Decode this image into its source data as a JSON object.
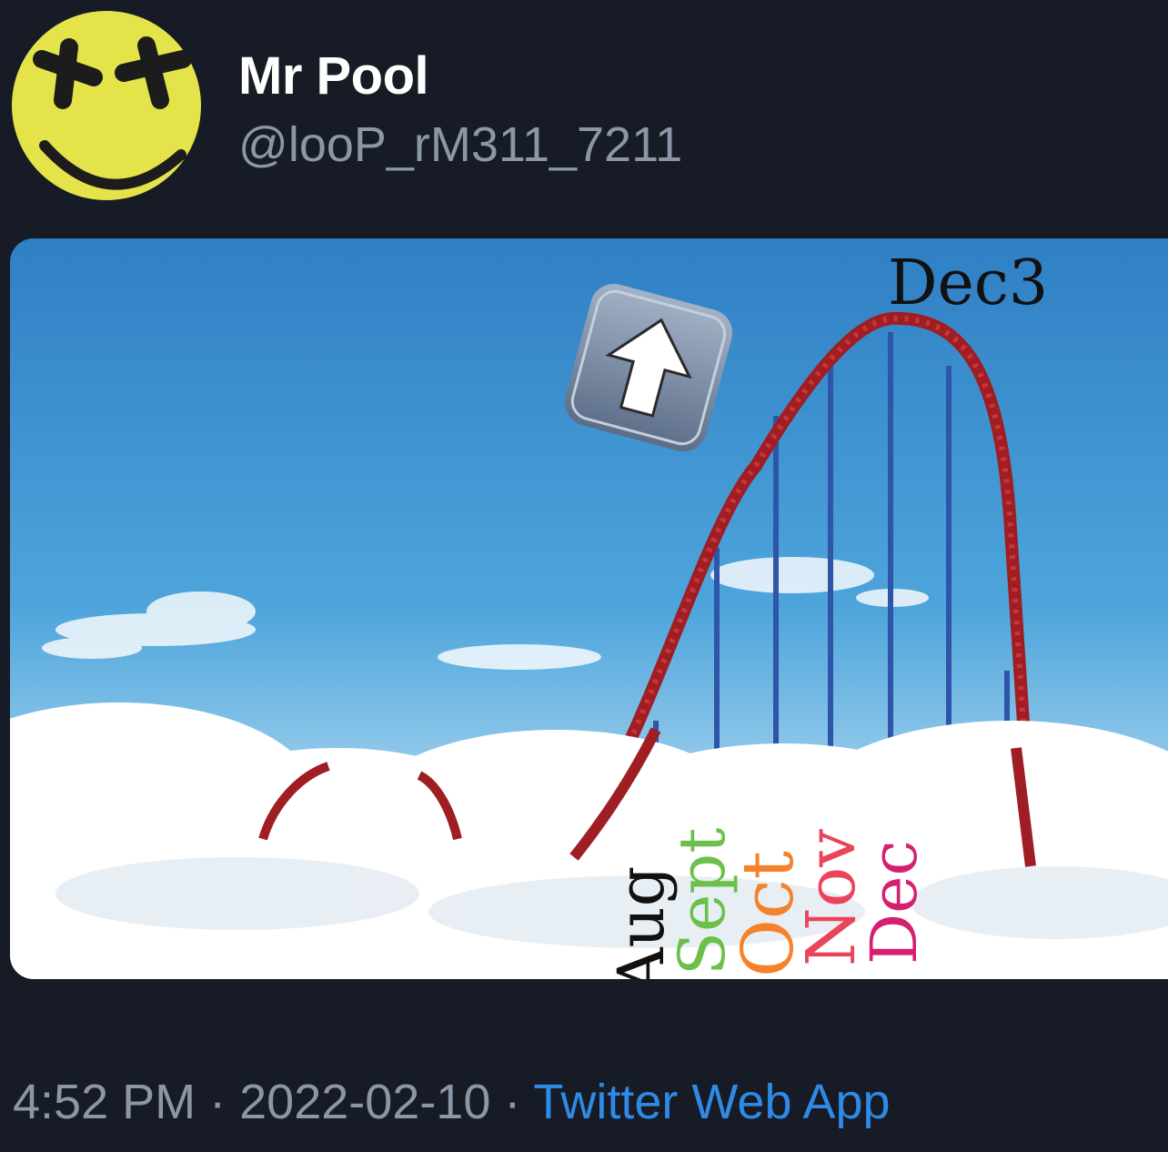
{
  "tweet": {
    "author_name": "Mr Pool",
    "author_handle": "@looP_rM311_7211",
    "time": "4:52 PM",
    "date": "2022-02-10",
    "separator": "·",
    "source_app": "Twitter Web App"
  },
  "meme": {
    "peak_label": "Dec3",
    "up_arrow_icon": "up-arrow-emoji-icon",
    "months": [
      {
        "label": "Aug",
        "color": "#111111"
      },
      {
        "label": "Sept",
        "color": "#6cc04a"
      },
      {
        "label": "Oct",
        "color": "#f5822a"
      },
      {
        "label": "Nov",
        "color": "#e9445a"
      },
      {
        "label": "Dec",
        "color": "#d6206f"
      }
    ]
  },
  "colors": {
    "background": "#161b26",
    "name": "#ffffff",
    "muted": "#8b97a6",
    "link": "#2f8ae6",
    "avatar": "#e4e44a"
  }
}
